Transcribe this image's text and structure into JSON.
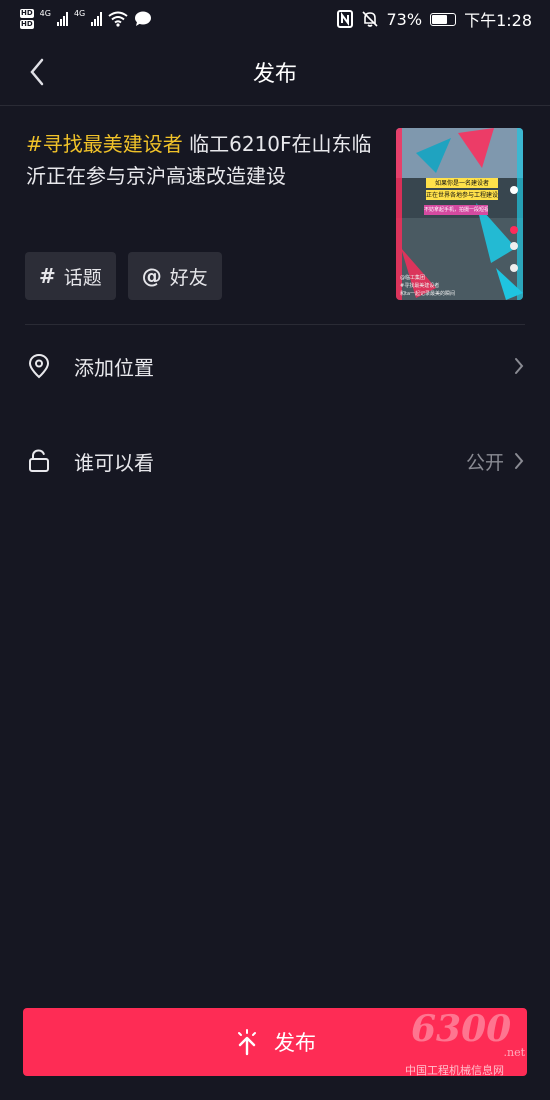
{
  "status_bar": {
    "network_label_1": "4G",
    "network_label_2": "4G",
    "battery_percent": "73%",
    "battery_level": 0.73,
    "time": "下午1:28",
    "icons": [
      "hd-icon",
      "signal-icon",
      "wifi-icon",
      "message-icon",
      "nfc-icon",
      "mute-icon",
      "battery-icon"
    ]
  },
  "header": {
    "title": "发布",
    "back_icon": "chevron-left-icon"
  },
  "caption": {
    "hashtag": "#寻找最美建设者",
    "text": " 临工6210F在山东临沂正在参与京沪高速改造建设"
  },
  "thumbnail": {
    "banner_line_1": "如果你是一名建设者",
    "banner_line_2": "正在世界各地参与工程建设",
    "banner_line_3": "不妨拿起手机，拍摄一段短视频",
    "author": "@临工集团",
    "caption_line_1": "#寻找最美建设者",
    "caption_line_2": "和ta一起记录最美的瞬间"
  },
  "chips": {
    "topic_symbol": "#",
    "topic_label": "话题",
    "mention_symbol": "@",
    "mention_label": "好友"
  },
  "rows": {
    "location_label": "添加位置",
    "visibility_label": "谁可以看",
    "visibility_value": "公开"
  },
  "publish_button": {
    "label": "发布"
  },
  "watermark": {
    "number": "6300",
    "domain_suffix": ".net",
    "site_name": "中国工程机械信息网"
  },
  "colors": {
    "background": "#161722",
    "accent": "#fe2c55",
    "hashtag": "#f0c229",
    "chip_bg": "#2c2d37"
  }
}
